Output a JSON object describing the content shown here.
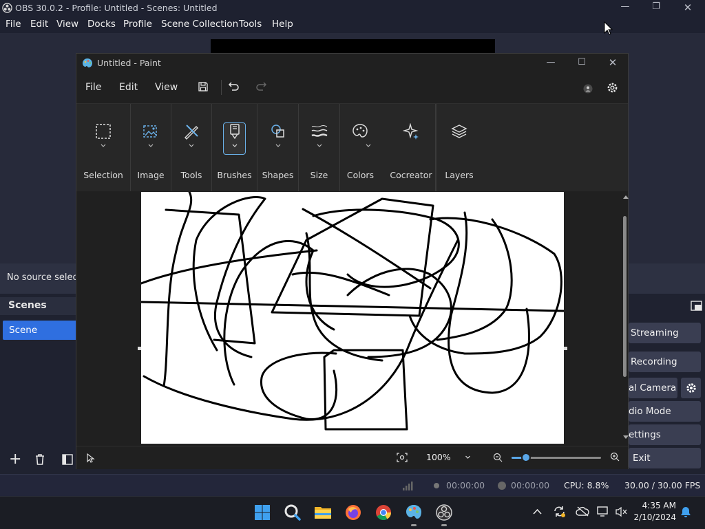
{
  "obs": {
    "title": "OBS 30.0.2 - Profile: Untitled - Scenes: Untitled",
    "menu": [
      "File",
      "Edit",
      "View",
      "Docks",
      "Profile",
      "Scene Collection",
      "Tools",
      "Help"
    ],
    "source_bar_text": "No source selecte",
    "scenes_header": "Scenes",
    "scene_item": "Scene",
    "controls": {
      "streaming": "Streaming",
      "recording": "Recording",
      "virtual_camera": "al Camera",
      "studio_mode": "dio Mode",
      "settings": "ettings",
      "exit": "Exit"
    },
    "status": {
      "stream_time": "00:00:00",
      "record_time": "00:00:00",
      "cpu": "CPU: 8.8%",
      "fps": "30.00 / 30.00 FPS"
    }
  },
  "paint": {
    "title": "Untitled - Paint",
    "menu": [
      "File",
      "Edit",
      "View"
    ],
    "ribbon": [
      "Selection",
      "Image",
      "Tools",
      "Brushes",
      "Shapes",
      "Size",
      "Colors",
      "Cocreator",
      "Layers"
    ],
    "zoom": "100%"
  },
  "taskbar": {
    "time": "4:35 AM",
    "date": "2/10/2024"
  },
  "colors": {
    "obs_accent": "#2f6fe0",
    "paint_bg": "#202020",
    "canvas": "#ffffff"
  }
}
